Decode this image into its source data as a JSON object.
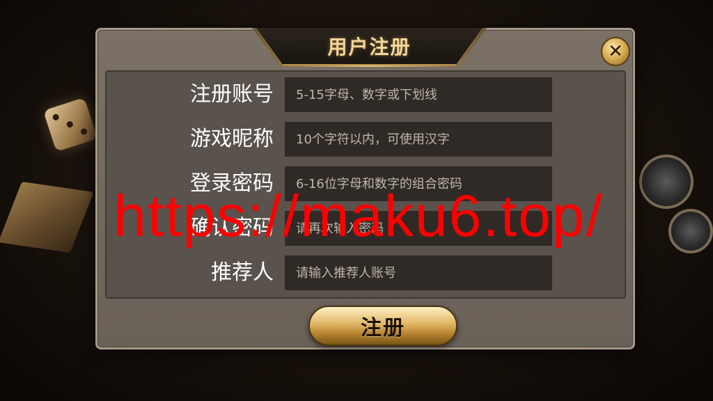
{
  "dialog": {
    "title": "用户注册",
    "close_icon": "close-icon",
    "close_glyph": "✕"
  },
  "form": {
    "rows": [
      {
        "label": "注册账号",
        "placeholder": "5-15字母、数字或下划线",
        "value": ""
      },
      {
        "label": "游戏昵称",
        "placeholder": "10个字符以内，可使用汉字",
        "value": ""
      },
      {
        "label": "登录密码",
        "placeholder": "6-16位字母和数字的组合密码",
        "value": ""
      },
      {
        "label": "确认密码",
        "placeholder": "请再次输入密码",
        "value": ""
      },
      {
        "label": "推荐人",
        "placeholder": "请输入推荐人账号",
        "value": ""
      }
    ]
  },
  "actions": {
    "register_label": "注册"
  },
  "watermark": {
    "text": "https://maku6.top/"
  },
  "colors": {
    "accent_gold": "#e0b564",
    "watermark_red": "#ff0000",
    "input_bg": "#302a26",
    "panel_bg": "#5a534d"
  }
}
